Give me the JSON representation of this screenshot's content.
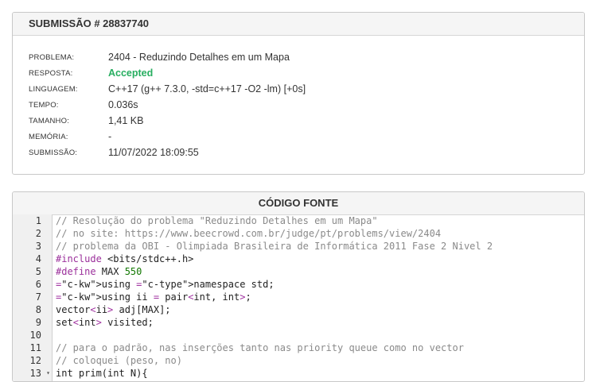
{
  "submission": {
    "header": "SUBMISSÃO # 28837740",
    "rows": [
      {
        "label": "PROBLEMA:",
        "value": "2404 - Reduzindo Detalhes em um Mapa"
      },
      {
        "label": "RESPOSTA:",
        "value": "Accepted"
      },
      {
        "label": "LINGUAGEM:",
        "value": "C++17 (g++ 7.3.0, -std=c++17 -O2 -lm) [+0s]"
      },
      {
        "label": "TEMPO:",
        "value": "0.036s"
      },
      {
        "label": "TAMANHO:",
        "value": "1,41 KB"
      },
      {
        "label": "MEMÓRIA:",
        "value": "-"
      },
      {
        "label": "SUBMISSÃO:",
        "value": "11/07/2022 18:09:55"
      }
    ],
    "status_color": "#27ae60"
  },
  "code": {
    "header": "CÓDIGO FONTE",
    "lines": [
      {
        "n": "1",
        "text": "// Resolução do problema \"Reduzindo Detalhes em um Mapa\""
      },
      {
        "n": "2",
        "text": "// no site: https://www.beecrowd.com.br/judge/pt/problems/view/2404"
      },
      {
        "n": "3",
        "text": "// problema da OBI - Olimpiada Brasileira de Informática 2011 Fase 2 Nivel 2"
      },
      {
        "n": "4",
        "text": "#include <bits/stdc++.h>"
      },
      {
        "n": "5",
        "text": "#define MAX 550"
      },
      {
        "n": "6",
        "text": "using namespace std;"
      },
      {
        "n": "7",
        "text": "using ii = pair<int, int>;"
      },
      {
        "n": "8",
        "text": "vector<ii> adj[MAX];"
      },
      {
        "n": "9",
        "text": "set<int> visited;"
      },
      {
        "n": "10",
        "text": ""
      },
      {
        "n": "11",
        "text": "// para o padrão, nas inserções tanto nas priority queue como no vector"
      },
      {
        "n": "12",
        "text": "// coloquei (peso, no)"
      },
      {
        "n": "13",
        "text": "int prim(int N){"
      }
    ]
  }
}
